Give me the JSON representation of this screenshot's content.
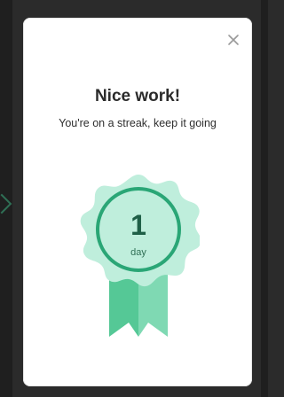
{
  "modal": {
    "title": "Nice work!",
    "subtitle": "You're on a streak, keep it going",
    "streak_count": "1",
    "streak_unit": "day"
  },
  "icons": {
    "close": "close-icon",
    "badge": "rosette-badge-icon"
  },
  "colors": {
    "badge_light": "#bfeedc",
    "badge_mid": "#7fd9b3",
    "badge_ribbon": "#55c896",
    "badge_ring": "#2aa676",
    "text_dark": "#2b2b2b"
  }
}
